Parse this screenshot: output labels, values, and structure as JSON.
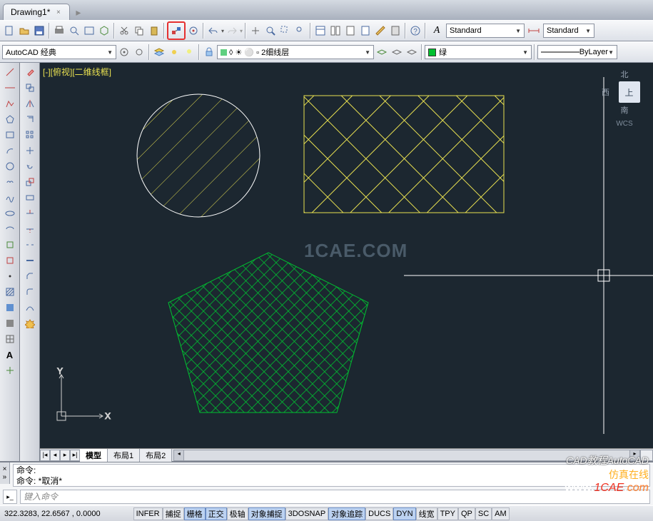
{
  "tab": {
    "title": "Drawing1*"
  },
  "toolbar2": {
    "workspace": "AutoCAD 经典",
    "layer_full": "◊ ☀ ⚪ ▫ 2细线层",
    "layer_color": "绿",
    "style1": "Standard",
    "style2": "Standard",
    "line": "ByLayer"
  },
  "canvas": {
    "view_label": "[-][俯视][二维线框]",
    "watermark": "1CAE.COM",
    "cube": {
      "n": "北",
      "w": "西",
      "s": "南",
      "top": "上",
      "wcs": "WCS"
    }
  },
  "sheets": {
    "model": "模型",
    "layout1": "布局1",
    "layout2": "布局2"
  },
  "cmd": {
    "hist1": "命令:",
    "hist2": "命令: *取消*",
    "placeholder": "键入命令"
  },
  "status": {
    "coords": "322.3283, 22.6567 , 0.0000",
    "btns": [
      "INFER",
      "捕捉",
      "栅格",
      "正交",
      "极轴",
      "对象捕捉",
      "3DOSNAP",
      "对象追踪",
      "DUCS",
      "DYN",
      "线宽",
      "TPY",
      "QP",
      "SC",
      "AM"
    ],
    "active": [
      2,
      3,
      5,
      7,
      9
    ]
  },
  "wm": {
    "cad": "CAD教程AutoCAD",
    "site": "www.1CAE.com",
    "sim": "仿真在线"
  },
  "chart_data": {
    "type": "diagram",
    "shapes": [
      {
        "shape": "circle",
        "hatch": "diagonal",
        "color": "#e8e050",
        "outline": "#ffffff"
      },
      {
        "shape": "rectangle",
        "hatch": "diamond-grid",
        "color": "#e8e050",
        "outline": "#e8e050"
      },
      {
        "shape": "pentagon",
        "hatch": "fine-crosshatch",
        "color": "#00c030",
        "outline": "#00c030"
      }
    ]
  }
}
